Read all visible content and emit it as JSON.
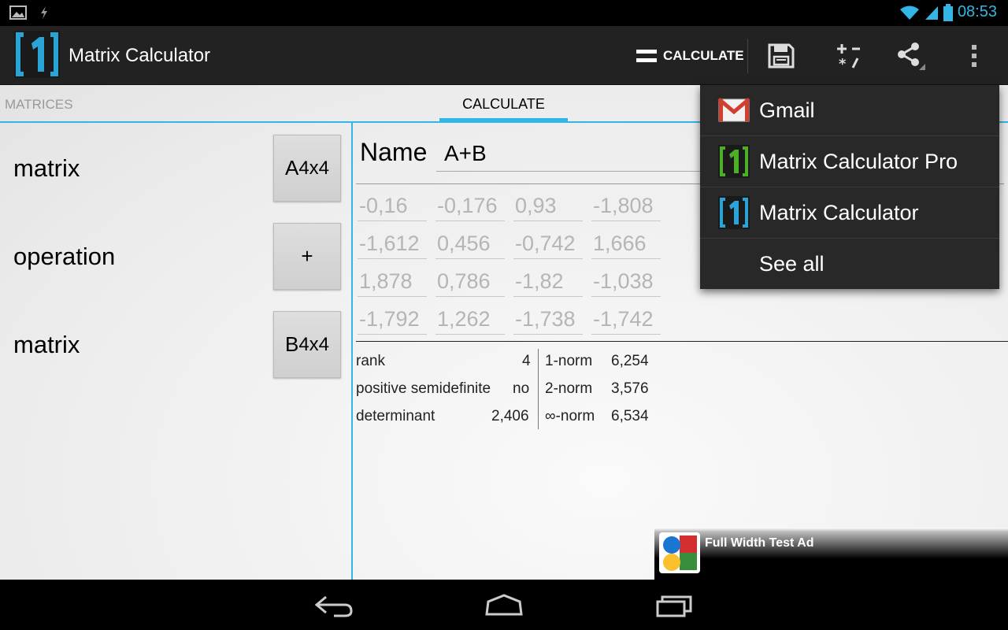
{
  "status_bar": {
    "time": "08:53"
  },
  "action_bar": {
    "title": "Matrix Calculator",
    "calculate_label": "CALCULATE"
  },
  "tabs": [
    {
      "label": "MATRICES"
    },
    {
      "label": "CALCULATE"
    }
  ],
  "left_panel": {
    "row1_label": "matrix",
    "row1_button": "A",
    "row1_sub": "4x4",
    "row2_label": "operation",
    "row2_button": "+",
    "row3_label": "matrix",
    "row3_button": "B",
    "row3_sub": "4x4"
  },
  "result": {
    "name_label": "Name",
    "name_value": "A+B",
    "matrix": [
      [
        "-0,16",
        "-0,176",
        "0,93",
        "-1,808"
      ],
      [
        "-1,612",
        "0,456",
        "-0,742",
        "1,666"
      ],
      [
        "1,878",
        "0,786",
        "-1,82",
        "-1,038"
      ],
      [
        "-1,792",
        "1,262",
        "-1,738",
        "-1,742"
      ]
    ],
    "properties_left": [
      {
        "label": "rank",
        "value": "4"
      },
      {
        "label": "positive semidefinite",
        "value": "no"
      },
      {
        "label": "determinant",
        "value": "2,406"
      }
    ],
    "properties_right": [
      {
        "label": "1-norm",
        "value": "6,254"
      },
      {
        "label": "2-norm",
        "value": "3,576"
      },
      {
        "label": "∞-norm",
        "value": "6,534"
      }
    ]
  },
  "share_menu": {
    "items": [
      {
        "label": "Gmail",
        "icon": "gmail-icon"
      },
      {
        "label": "Matrix Calculator Pro",
        "icon": "matrix-calculator-pro-icon"
      },
      {
        "label": "Matrix Calculator",
        "icon": "matrix-calculator-icon"
      },
      {
        "label": "See all"
      }
    ]
  },
  "ad": {
    "text": "Full Width Test Ad"
  },
  "colors": {
    "accent": "#33b5e5",
    "action_bar": "#222222",
    "menu_bg": "#282828"
  }
}
